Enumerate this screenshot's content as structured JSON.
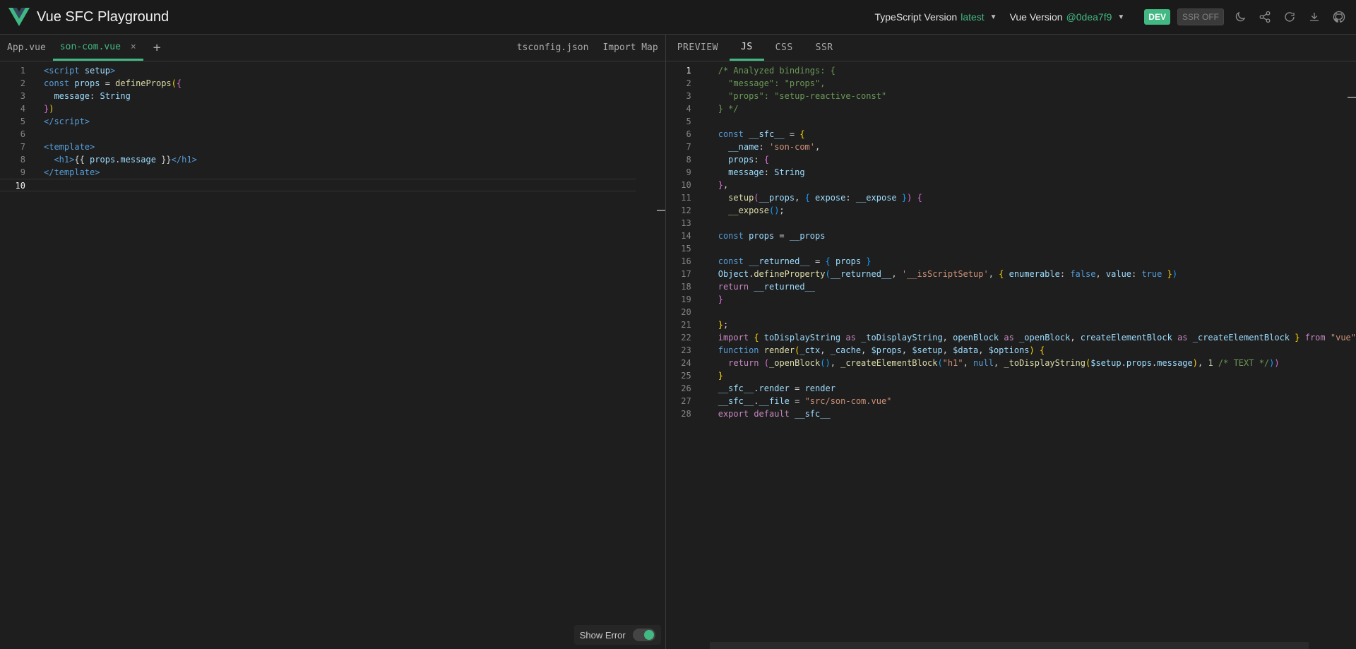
{
  "header": {
    "title": "Vue SFC Playground",
    "ts_label": "TypeScript Version",
    "ts_value": "latest",
    "vue_label": "Vue Version",
    "vue_value": "@0dea7f9",
    "dev_badge": "DEV",
    "ssr_badge": "SSR OFF",
    "icons": [
      "moon-icon",
      "share-icon",
      "reload-icon",
      "download-icon",
      "github-icon"
    ]
  },
  "editor": {
    "tabs": [
      {
        "label": "App.vue",
        "active": false
      },
      {
        "label": "son-com.vue",
        "active": true
      }
    ],
    "close_glyph": "×",
    "add_glyph": "+",
    "tsconfig": "tsconfig.json",
    "import_map": "Import Map",
    "show_error": "Show Error"
  },
  "output": {
    "tabs": [
      "PREVIEW",
      "JS",
      "CSS",
      "SSR"
    ],
    "active_tab": "JS"
  },
  "colors": {
    "accent": "#42b883",
    "background": "#1e1e1e"
  }
}
